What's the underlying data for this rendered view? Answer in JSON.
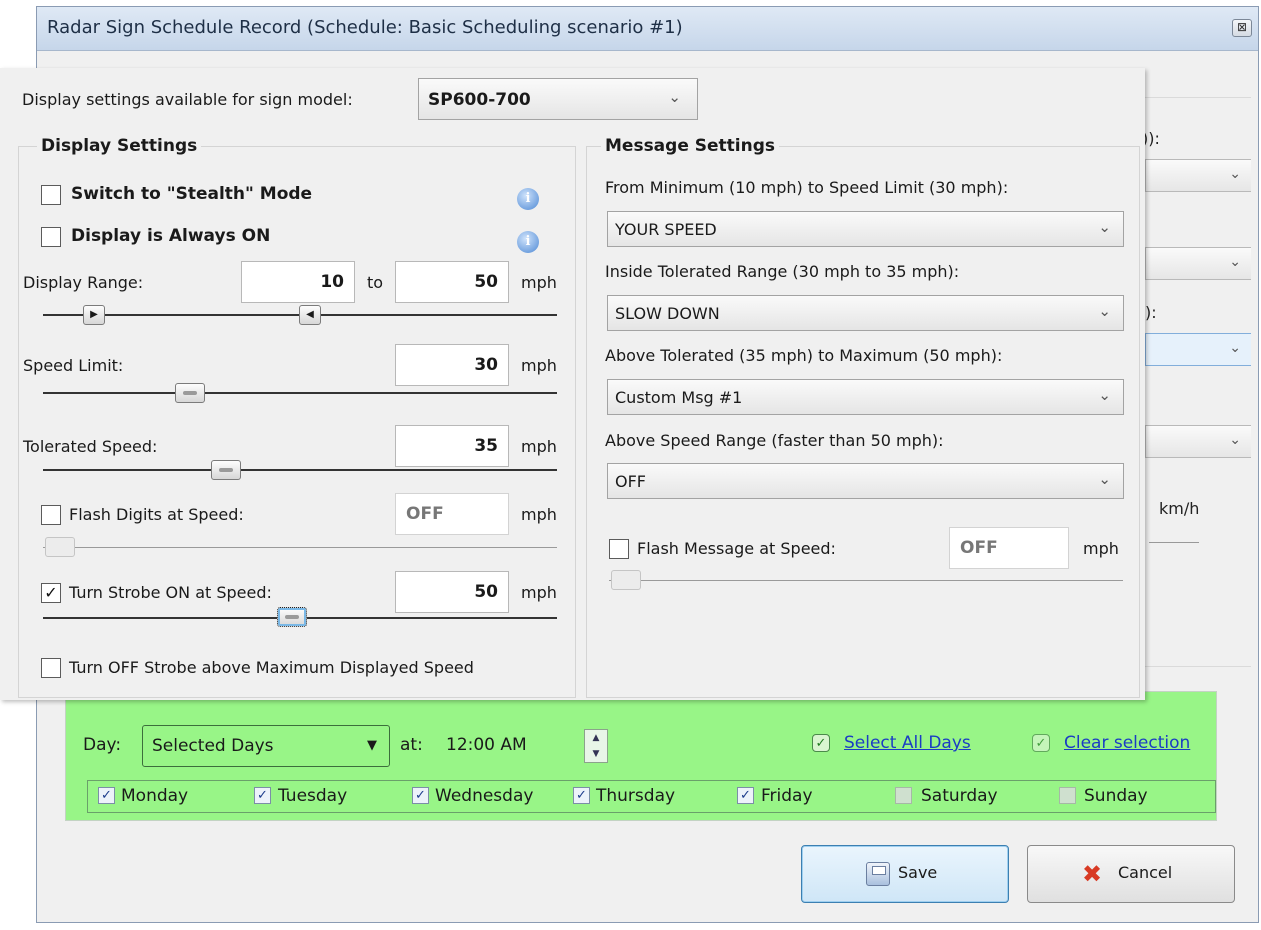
{
  "window": {
    "title": "Radar Sign Schedule Record (Schedule: Basic Scheduling scenario #1)",
    "close_glyph": "⊠"
  },
  "background_fragments": {
    "labels": [
      "\u0000"
    ],
    "label_1": ")):",
    "label_2": "):",
    "unit": "km/h",
    "chevron": "⌄"
  },
  "model": {
    "label": "Display settings available for sign model:",
    "value": "SP600-700"
  },
  "display_settings": {
    "title": "Display Settings",
    "stealth": {
      "label": "Switch to \"Stealth\" Mode",
      "checked": false
    },
    "always_on": {
      "label": "Display is Always ON",
      "checked": false
    },
    "info_glyph": "i",
    "range": {
      "label": "Display Range:",
      "from": "10",
      "to_label": "to",
      "to": "50",
      "unit": "mph"
    },
    "speed_limit": {
      "label": "Speed Limit:",
      "value": "30",
      "unit": "mph"
    },
    "tolerated": {
      "label": "Tolerated Speed:",
      "value": "35",
      "unit": "mph"
    },
    "flash_digits": {
      "label": "Flash Digits at Speed:",
      "value": "OFF",
      "unit": "mph",
      "checked": false
    },
    "strobe": {
      "label": "Turn Strobe ON at Speed:",
      "value": "50",
      "unit": "mph",
      "checked": true
    },
    "strobe_off": {
      "label": "Turn OFF Strobe above Maximum Displayed Speed",
      "checked": false
    }
  },
  "message_settings": {
    "title": "Message Settings",
    "min_to_limit": {
      "label": "From Minimum (10 mph) to Speed Limit (30 mph):",
      "value": "YOUR SPEED"
    },
    "tolerated_range": {
      "label": "Inside Tolerated Range (30 mph to 35 mph):",
      "value": "SLOW DOWN"
    },
    "above_tolerated": {
      "label": "Above Tolerated (35 mph) to Maximum (50 mph):",
      "value": "Custom Msg #1"
    },
    "above_range": {
      "label": "Above Speed Range (faster than 50 mph):",
      "value": "OFF"
    },
    "flash_message": {
      "label": "Flash Message at Speed:",
      "value": "OFF",
      "unit": "mph",
      "checked": false
    }
  },
  "schedule": {
    "day_label": "Day:",
    "day_value": "Selected Days",
    "at_label": "at:",
    "time_value": "12:00 AM",
    "select_all": "Select All Days",
    "clear": "Clear selection",
    "days": [
      {
        "name": "Monday",
        "checked": true
      },
      {
        "name": "Tuesday",
        "checked": true
      },
      {
        "name": "Wednesday",
        "checked": true
      },
      {
        "name": "Thursday",
        "checked": true
      },
      {
        "name": "Friday",
        "checked": true
      },
      {
        "name": "Saturday",
        "checked": false
      },
      {
        "name": "Sunday",
        "checked": false
      }
    ]
  },
  "buttons": {
    "save": "Save",
    "cancel": "Cancel"
  },
  "glyphs": {
    "check": "✓",
    "chevron": "⌄",
    "dropdown": "▼",
    "close": "⊠",
    "cancel_x": "✖",
    "right": "▶",
    "left": "◀",
    "spin_up": "▲",
    "spin_down": "▼"
  },
  "sliders": {
    "range_min_fraction": 0.0,
    "range_max_fraction": 0.5,
    "speed_limit_fraction": 0.25,
    "tolerated_fraction": 0.31,
    "strobe_fraction": 0.5
  }
}
